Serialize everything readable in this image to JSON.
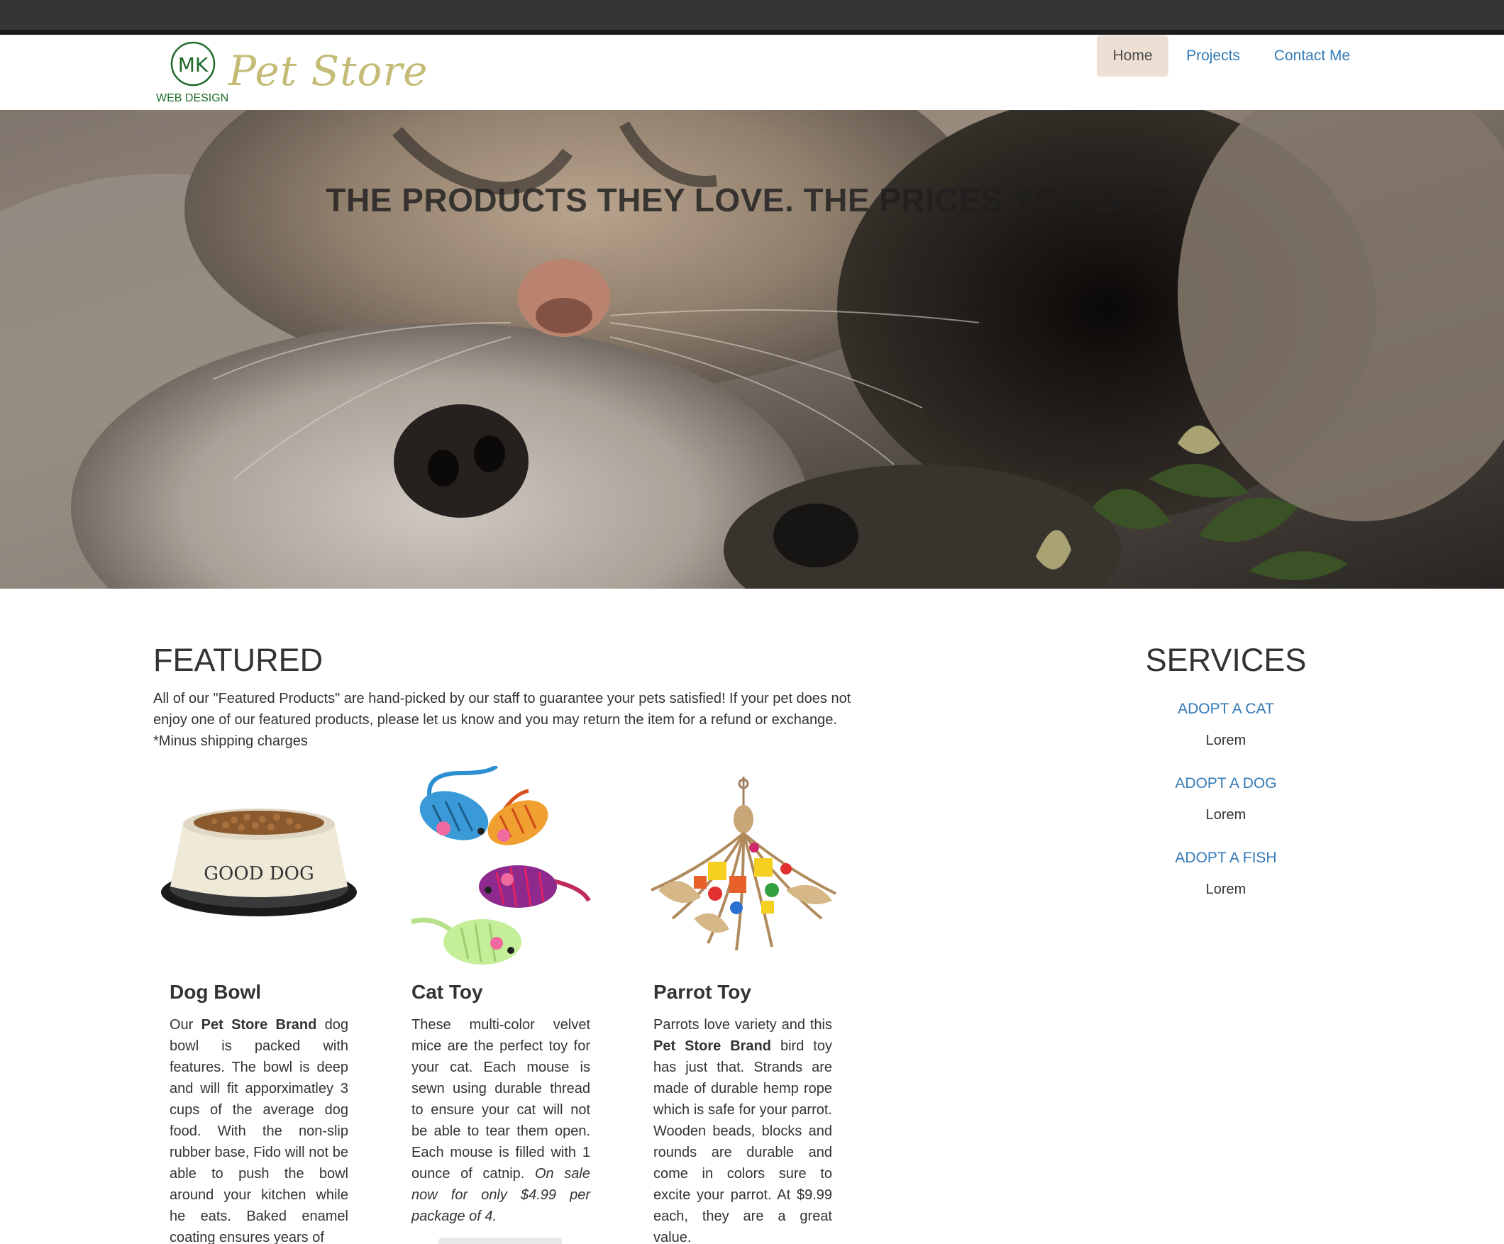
{
  "brand": {
    "logo_monogram": "MK",
    "logo_caption": "WEB DESIGN",
    "name": "Pet Store"
  },
  "nav": {
    "home": "Home",
    "projects": "Projects",
    "contact": "Contact Me"
  },
  "hero": {
    "heading": "THE PRODUCTS THEY LOVE. THE PRICES YOU LIKE."
  },
  "featured": {
    "title": "FEATURED",
    "intro": "All of our \"Featured Products\" are hand-picked by our staff to guarantee your pets satisfied! If your pet does not enjoy one of our featured products, please let us know and you may return the item for a refund or exchange. *Minus shipping charges",
    "products": [
      {
        "name": "Dog Bowl",
        "bowl_label": "GOOD DOG",
        "desc_1": "Our ",
        "brand": "Pet Store Brand",
        "desc_2": " dog bowl is packed with features. The bowl is deep and will fit apporximatley 3 cups of the average dog food. With the non-slip rubber base, Fido will not be able to push the bowl around your kitchen while he eats. Baked enamel coating ensures years of"
      },
      {
        "name": "Cat Toy",
        "desc_1": "These multi-color velvet mice are the perfect toy for your cat. Each mouse is sewn using durable thread to ensure your cat will not be able to tear them open. Each mouse is filled with 1 ounce of catnip. ",
        "sale": "On sale now for only $4.99 per package of 4."
      },
      {
        "name": "Parrot Toy",
        "desc_1": "Parrots love variety and this ",
        "brand": "Pet Store Brand",
        "desc_2": " bird toy has just that. Strands are made of durable hemp rope which is safe for your parrot. Wooden beads, blocks and rounds are durable and come in colors sure to excite your parrot. At $9.99 each, they are a great value."
      }
    ]
  },
  "services": {
    "title": "SERVICES",
    "items": [
      {
        "label": "ADOPT A CAT",
        "text": "Lorem"
      },
      {
        "label": "ADOPT A DOG",
        "text": "Lorem"
      },
      {
        "label": "ADOPT A FISH",
        "text": "Lorem"
      }
    ]
  },
  "colors": {
    "link": "#337ab7",
    "nav_active_bg": "#eddfd3",
    "brand_text": "#c4bb77",
    "logo_green": "#1f6b2a",
    "topbar": "#353535"
  }
}
